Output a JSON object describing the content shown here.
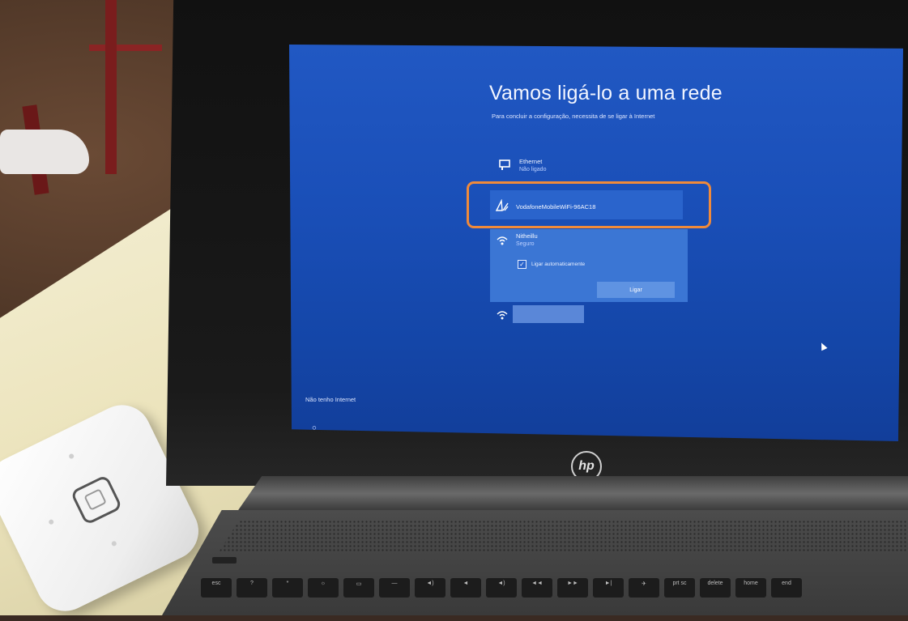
{
  "screen": {
    "title": "Vamos ligá-lo a uma rede",
    "subtitle": "Para concluir a configuração, necessita de se ligar à Internet",
    "networks": [
      {
        "icon": "ethernet-icon",
        "name": "Ethernet",
        "status": "Não ligado"
      },
      {
        "icon": "mobile-broadband-icon",
        "name": "VodafoneMobileWiFi-96AC18",
        "status": ""
      },
      {
        "icon": "wifi-secured-icon",
        "name": "Nitheillu",
        "status": "Seguro"
      },
      {
        "icon": "wifi-secured-icon",
        "name": "",
        "status": ""
      }
    ],
    "auto_connect_label": "Ligar automaticamente",
    "auto_connect_checked": true,
    "connect_button": "Ligar",
    "no_internet_link": "Não tenho Internet",
    "accessibility_icon": "accessibility-icon"
  },
  "laptop": {
    "brand": "hp"
  },
  "keyboard": {
    "top_row": [
      "esc",
      "?",
      "*",
      "☼",
      "▭",
      "—",
      "◄)",
      "◄",
      "◄)",
      "◄◄",
      "►►",
      "►|",
      "✈",
      "prt sc",
      "delete",
      "home",
      "end"
    ]
  },
  "colors": {
    "screen_blue": "#1a4fb8",
    "highlight_orange": "#f08a3a"
  }
}
